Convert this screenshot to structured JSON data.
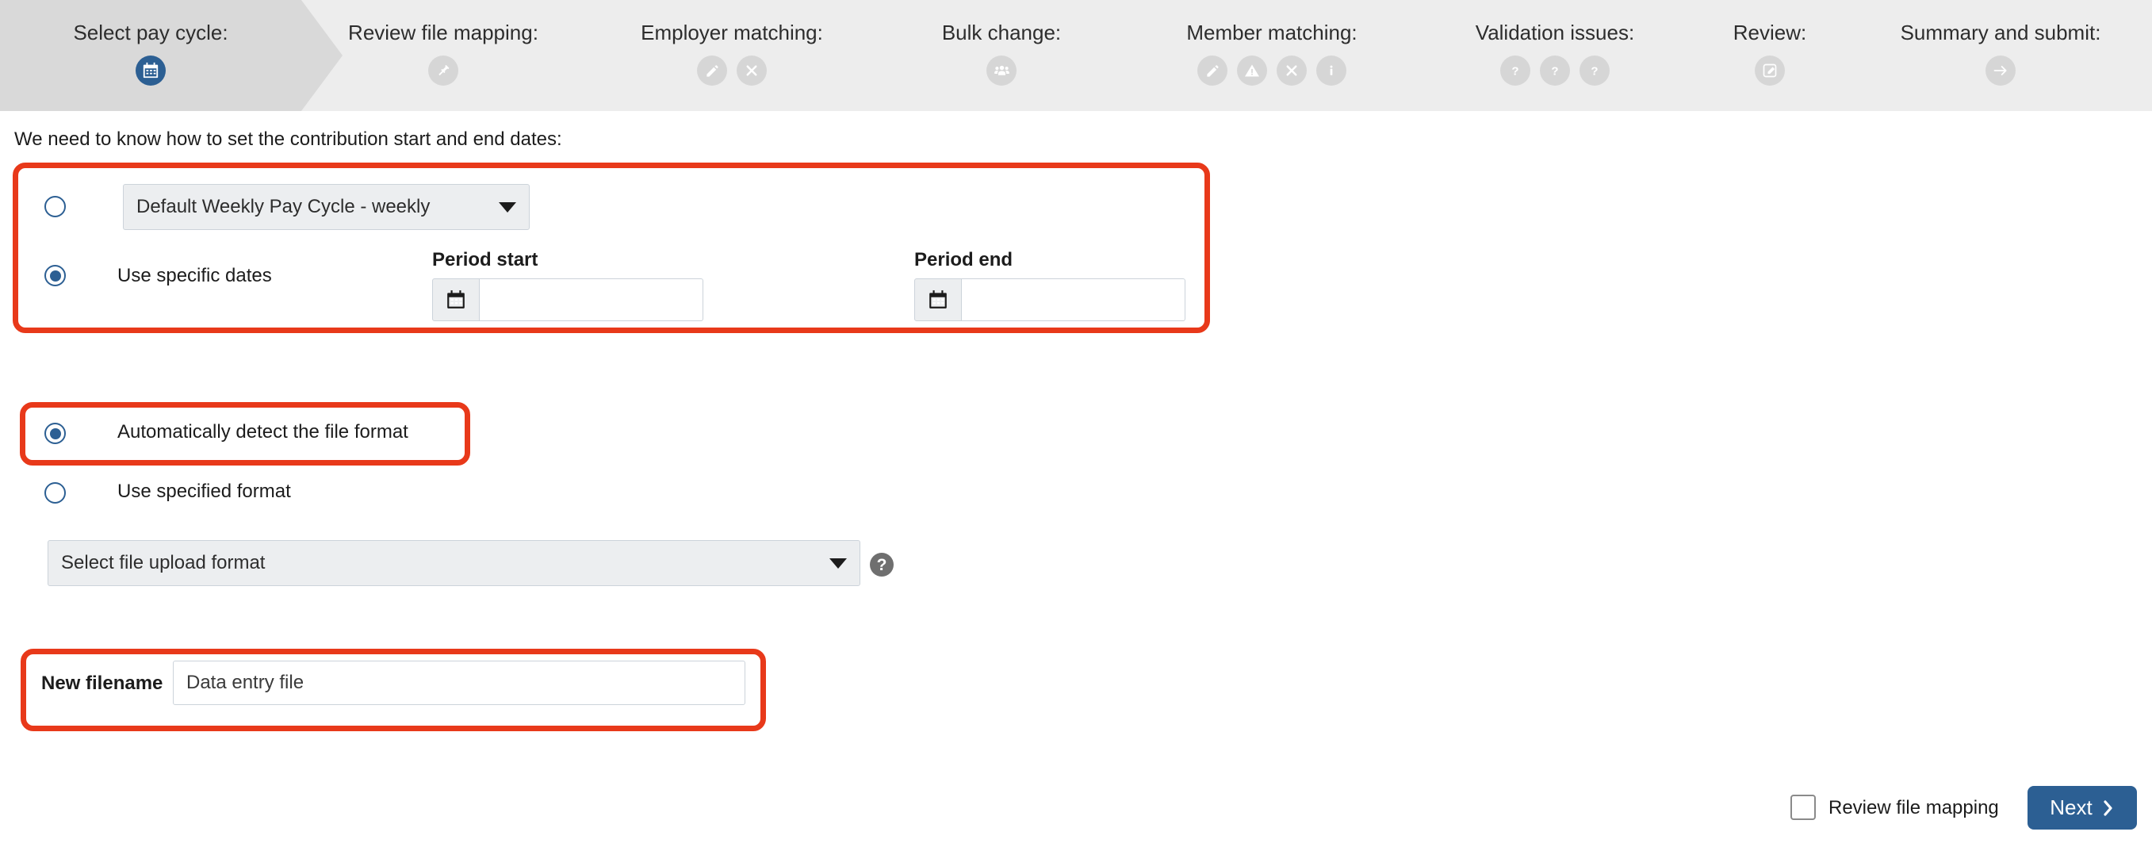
{
  "colors": {
    "accent_blue": "#2C5F93",
    "highlight_red": "#E8391A",
    "step_active_bg": "#D9D9D9",
    "step_inactive_bg": "#EDEDED",
    "help_icon_gray": "#6F6F6F"
  },
  "steps": [
    {
      "label": "Select pay cycle:",
      "active": true,
      "icons": [
        "calendar-icon"
      ]
    },
    {
      "label": "Review file mapping:",
      "active": false,
      "icons": [
        "plug-icon"
      ]
    },
    {
      "label": "Employer matching:",
      "active": false,
      "icons": [
        "pencil-icon",
        "cross-icon"
      ]
    },
    {
      "label": "Bulk change:",
      "active": false,
      "icons": [
        "people-icon"
      ]
    },
    {
      "label": "Member matching:",
      "active": false,
      "icons": [
        "pencil-icon",
        "warning-icon",
        "cross-icon",
        "info-icon"
      ]
    },
    {
      "label": "Validation issues:",
      "active": false,
      "icons": [
        "question-icon",
        "question-icon",
        "question-icon"
      ]
    },
    {
      "label": "Review:",
      "active": false,
      "icons": [
        "edit-square-icon"
      ]
    },
    {
      "label": "Summary and submit:",
      "active": false,
      "icons": [
        "arrow-right-icon"
      ]
    }
  ],
  "main": {
    "intro_text": "We need to know how to set the contribution start and end dates:",
    "pay_cycle": {
      "radio_paycycle_selected": false,
      "paycycle_select_value": "Default Weekly Pay Cycle - weekly",
      "radio_specific_dates_selected": true,
      "specific_dates_label": "Use specific dates",
      "period_start_label": "Period start",
      "period_start_value": "",
      "period_end_label": "Period end",
      "period_end_value": ""
    },
    "file_format": {
      "auto_detect_label": "Automatically detect the file format",
      "auto_detect_selected": true,
      "use_specified_label": "Use specified format",
      "use_specified_selected": false,
      "format_select_value": "Select file upload format",
      "help_glyph": "?"
    },
    "filename": {
      "label": "New filename",
      "value": "Data entry file"
    }
  },
  "footer": {
    "review_mapping_label": "Review file mapping",
    "review_mapping_checked": false,
    "next_label": "Next"
  }
}
